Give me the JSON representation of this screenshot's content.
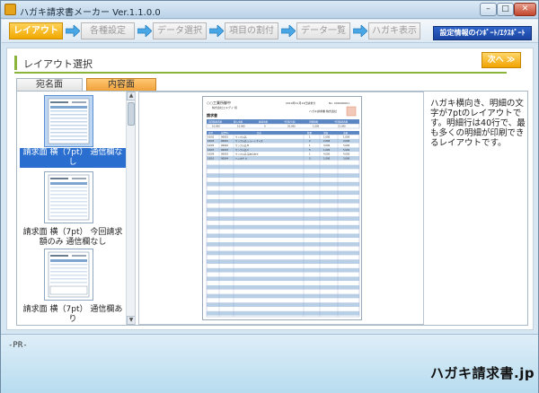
{
  "window": {
    "title": "ハガキ請求書メーカー Ver.1.1.0.0",
    "controls": {
      "minimize": "–",
      "maximize": "□",
      "close": "✕"
    }
  },
  "steps": [
    {
      "label": "レイアウト",
      "active": true
    },
    {
      "label": "各種設定",
      "active": false
    },
    {
      "label": "データ選択",
      "active": false
    },
    {
      "label": "項目の割付",
      "active": false
    },
    {
      "label": "データ一覧",
      "active": false
    },
    {
      "label": "ハガキ表示",
      "active": false
    }
  ],
  "settings_button": "設定情報のｲﾝﾎﾟｰﾄ/ｴｸｽﾎﾟｰﾄ",
  "section": {
    "title": "レイアウト選択",
    "next_button": "次へ ≫"
  },
  "tabs": [
    {
      "label": "宛名面",
      "active": false
    },
    {
      "label": "内容面",
      "active": true
    }
  ],
  "layouts": [
    {
      "label": "請求面 横（7pt） 通信欄なし",
      "selected": true
    },
    {
      "label": "請求面 横（7pt） 今回請求額のみ 通信欄なし",
      "selected": false
    },
    {
      "label": "請求面 横（7pt） 通信欄あり",
      "selected": false
    }
  ],
  "scrollbar": {
    "up": "▲",
    "down": "▼"
  },
  "description": "ハガキ横向き、明細の文字が7ptのレイアウトです。明細行は40行で、最も多くの明細が印刷できるレイアウトです。",
  "preview": {
    "heading": "請求書",
    "recipient": "○○工業所御中",
    "company": "株式会社エキグイ 様",
    "date": "2010年11月14日請求分",
    "number": "No. 000000001",
    "sender": "ハガキ請求書 株式会社",
    "summary_headers": [
      "前回御請求額",
      "御入金額",
      "繰越金額",
      "今回取引額",
      "消費税額",
      "今回御請求額"
    ],
    "summary_values": [
      "10,000",
      "10,000",
      "0",
      "20,000",
      "1,000",
      "21,000"
    ],
    "detail_headers": [
      "日付",
      "伝票No",
      "品名",
      "数量",
      "単価",
      "金額"
    ],
    "detail_rows": [
      [
        "10/02",
        "00001",
        "サンプル品",
        "1",
        "1,000",
        "1,000"
      ],
      [
        "10/03",
        "00001",
        "サンプル品 ショートサイズ",
        "2",
        "2,000",
        "4,000"
      ],
      [
        "10/05",
        "00002",
        "サンプル品 B",
        "1",
        "3,000",
        "3,000"
      ],
      [
        "10/07",
        "00003",
        "サンプル品 C",
        "5",
        "1,000",
        "5,000"
      ],
      [
        "10/09",
        "00003",
        "サンプル品 詰め合わせ",
        "1",
        "4,000",
        "4,000"
      ],
      [
        "10/10",
        "00004",
        "ハンカチ 小",
        "3",
        "1,000",
        "3,000"
      ]
    ]
  },
  "footer": {
    "pr_label": "-PR-",
    "brand": "ハガキ請求書.jp"
  },
  "colors": {
    "accent": "#f1a800",
    "section_line": "#8ab43a",
    "settings": "#1a44a0",
    "selection": "#2a6fd0",
    "stripe": "#b9cfe6"
  }
}
